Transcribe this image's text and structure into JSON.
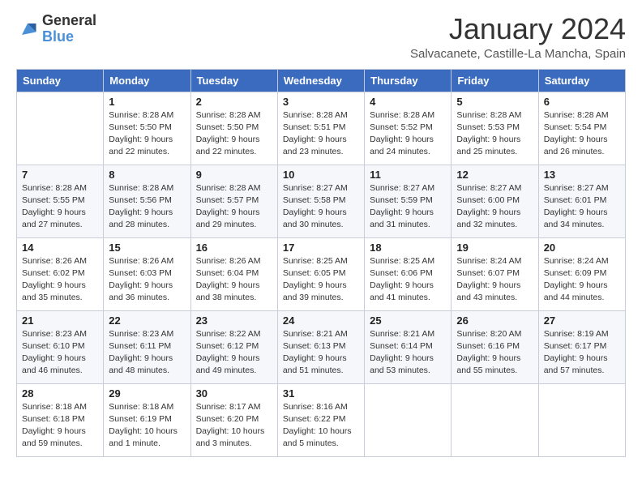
{
  "logo": {
    "general": "General",
    "blue": "Blue"
  },
  "title": "January 2024",
  "location": "Salvacanete, Castille-La Mancha, Spain",
  "days_of_week": [
    "Sunday",
    "Monday",
    "Tuesday",
    "Wednesday",
    "Thursday",
    "Friday",
    "Saturday"
  ],
  "weeks": [
    [
      {
        "day": "",
        "sunrise": "",
        "sunset": "",
        "daylight": ""
      },
      {
        "day": "1",
        "sunrise": "Sunrise: 8:28 AM",
        "sunset": "Sunset: 5:50 PM",
        "daylight": "Daylight: 9 hours and 22 minutes."
      },
      {
        "day": "2",
        "sunrise": "Sunrise: 8:28 AM",
        "sunset": "Sunset: 5:50 PM",
        "daylight": "Daylight: 9 hours and 22 minutes."
      },
      {
        "day": "3",
        "sunrise": "Sunrise: 8:28 AM",
        "sunset": "Sunset: 5:51 PM",
        "daylight": "Daylight: 9 hours and 23 minutes."
      },
      {
        "day": "4",
        "sunrise": "Sunrise: 8:28 AM",
        "sunset": "Sunset: 5:52 PM",
        "daylight": "Daylight: 9 hours and 24 minutes."
      },
      {
        "day": "5",
        "sunrise": "Sunrise: 8:28 AM",
        "sunset": "Sunset: 5:53 PM",
        "daylight": "Daylight: 9 hours and 25 minutes."
      },
      {
        "day": "6",
        "sunrise": "Sunrise: 8:28 AM",
        "sunset": "Sunset: 5:54 PM",
        "daylight": "Daylight: 9 hours and 26 minutes."
      }
    ],
    [
      {
        "day": "7",
        "sunrise": "Sunrise: 8:28 AM",
        "sunset": "Sunset: 5:55 PM",
        "daylight": "Daylight: 9 hours and 27 minutes."
      },
      {
        "day": "8",
        "sunrise": "Sunrise: 8:28 AM",
        "sunset": "Sunset: 5:56 PM",
        "daylight": "Daylight: 9 hours and 28 minutes."
      },
      {
        "day": "9",
        "sunrise": "Sunrise: 8:28 AM",
        "sunset": "Sunset: 5:57 PM",
        "daylight": "Daylight: 9 hours and 29 minutes."
      },
      {
        "day": "10",
        "sunrise": "Sunrise: 8:27 AM",
        "sunset": "Sunset: 5:58 PM",
        "daylight": "Daylight: 9 hours and 30 minutes."
      },
      {
        "day": "11",
        "sunrise": "Sunrise: 8:27 AM",
        "sunset": "Sunset: 5:59 PM",
        "daylight": "Daylight: 9 hours and 31 minutes."
      },
      {
        "day": "12",
        "sunrise": "Sunrise: 8:27 AM",
        "sunset": "Sunset: 6:00 PM",
        "daylight": "Daylight: 9 hours and 32 minutes."
      },
      {
        "day": "13",
        "sunrise": "Sunrise: 8:27 AM",
        "sunset": "Sunset: 6:01 PM",
        "daylight": "Daylight: 9 hours and 34 minutes."
      }
    ],
    [
      {
        "day": "14",
        "sunrise": "Sunrise: 8:26 AM",
        "sunset": "Sunset: 6:02 PM",
        "daylight": "Daylight: 9 hours and 35 minutes."
      },
      {
        "day": "15",
        "sunrise": "Sunrise: 8:26 AM",
        "sunset": "Sunset: 6:03 PM",
        "daylight": "Daylight: 9 hours and 36 minutes."
      },
      {
        "day": "16",
        "sunrise": "Sunrise: 8:26 AM",
        "sunset": "Sunset: 6:04 PM",
        "daylight": "Daylight: 9 hours and 38 minutes."
      },
      {
        "day": "17",
        "sunrise": "Sunrise: 8:25 AM",
        "sunset": "Sunset: 6:05 PM",
        "daylight": "Daylight: 9 hours and 39 minutes."
      },
      {
        "day": "18",
        "sunrise": "Sunrise: 8:25 AM",
        "sunset": "Sunset: 6:06 PM",
        "daylight": "Daylight: 9 hours and 41 minutes."
      },
      {
        "day": "19",
        "sunrise": "Sunrise: 8:24 AM",
        "sunset": "Sunset: 6:07 PM",
        "daylight": "Daylight: 9 hours and 43 minutes."
      },
      {
        "day": "20",
        "sunrise": "Sunrise: 8:24 AM",
        "sunset": "Sunset: 6:09 PM",
        "daylight": "Daylight: 9 hours and 44 minutes."
      }
    ],
    [
      {
        "day": "21",
        "sunrise": "Sunrise: 8:23 AM",
        "sunset": "Sunset: 6:10 PM",
        "daylight": "Daylight: 9 hours and 46 minutes."
      },
      {
        "day": "22",
        "sunrise": "Sunrise: 8:23 AM",
        "sunset": "Sunset: 6:11 PM",
        "daylight": "Daylight: 9 hours and 48 minutes."
      },
      {
        "day": "23",
        "sunrise": "Sunrise: 8:22 AM",
        "sunset": "Sunset: 6:12 PM",
        "daylight": "Daylight: 9 hours and 49 minutes."
      },
      {
        "day": "24",
        "sunrise": "Sunrise: 8:21 AM",
        "sunset": "Sunset: 6:13 PM",
        "daylight": "Daylight: 9 hours and 51 minutes."
      },
      {
        "day": "25",
        "sunrise": "Sunrise: 8:21 AM",
        "sunset": "Sunset: 6:14 PM",
        "daylight": "Daylight: 9 hours and 53 minutes."
      },
      {
        "day": "26",
        "sunrise": "Sunrise: 8:20 AM",
        "sunset": "Sunset: 6:16 PM",
        "daylight": "Daylight: 9 hours and 55 minutes."
      },
      {
        "day": "27",
        "sunrise": "Sunrise: 8:19 AM",
        "sunset": "Sunset: 6:17 PM",
        "daylight": "Daylight: 9 hours and 57 minutes."
      }
    ],
    [
      {
        "day": "28",
        "sunrise": "Sunrise: 8:18 AM",
        "sunset": "Sunset: 6:18 PM",
        "daylight": "Daylight: 9 hours and 59 minutes."
      },
      {
        "day": "29",
        "sunrise": "Sunrise: 8:18 AM",
        "sunset": "Sunset: 6:19 PM",
        "daylight": "Daylight: 10 hours and 1 minute."
      },
      {
        "day": "30",
        "sunrise": "Sunrise: 8:17 AM",
        "sunset": "Sunset: 6:20 PM",
        "daylight": "Daylight: 10 hours and 3 minutes."
      },
      {
        "day": "31",
        "sunrise": "Sunrise: 8:16 AM",
        "sunset": "Sunset: 6:22 PM",
        "daylight": "Daylight: 10 hours and 5 minutes."
      },
      {
        "day": "",
        "sunrise": "",
        "sunset": "",
        "daylight": ""
      },
      {
        "day": "",
        "sunrise": "",
        "sunset": "",
        "daylight": ""
      },
      {
        "day": "",
        "sunrise": "",
        "sunset": "",
        "daylight": ""
      }
    ]
  ]
}
